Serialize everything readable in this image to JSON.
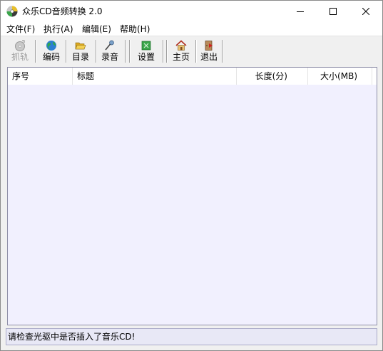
{
  "window": {
    "title": "众乐CD音频转换 2.0"
  },
  "menu": {
    "items": [
      "文件(F)",
      "执行(A)",
      "编辑(E)",
      "帮助(H)"
    ]
  },
  "toolbar": {
    "buttons": [
      {
        "label": "抓轨",
        "icon": "cd-disc-icon",
        "enabled": false
      },
      {
        "label": "编码",
        "icon": "globe-icon",
        "enabled": true
      },
      {
        "label": "目录",
        "icon": "folder-open-icon",
        "enabled": true
      },
      {
        "label": "录音",
        "icon": "microphone-icon",
        "enabled": true
      },
      {
        "label": "设置",
        "icon": "settings-icon",
        "enabled": true
      },
      {
        "label": "主页",
        "icon": "home-icon",
        "enabled": true
      },
      {
        "label": "退出",
        "icon": "exit-door-icon",
        "enabled": true
      }
    ]
  },
  "list": {
    "columns": [
      "序号",
      "标题",
      "长度(分)",
      "大小(MB)"
    ],
    "rows": []
  },
  "status": {
    "message": "请检查光驱中是否插入了音乐CD!"
  },
  "colors": {
    "list_background": "#f1f0fe",
    "status_background": "#e8e8f6",
    "disabled_text": "#a0a0a0"
  }
}
